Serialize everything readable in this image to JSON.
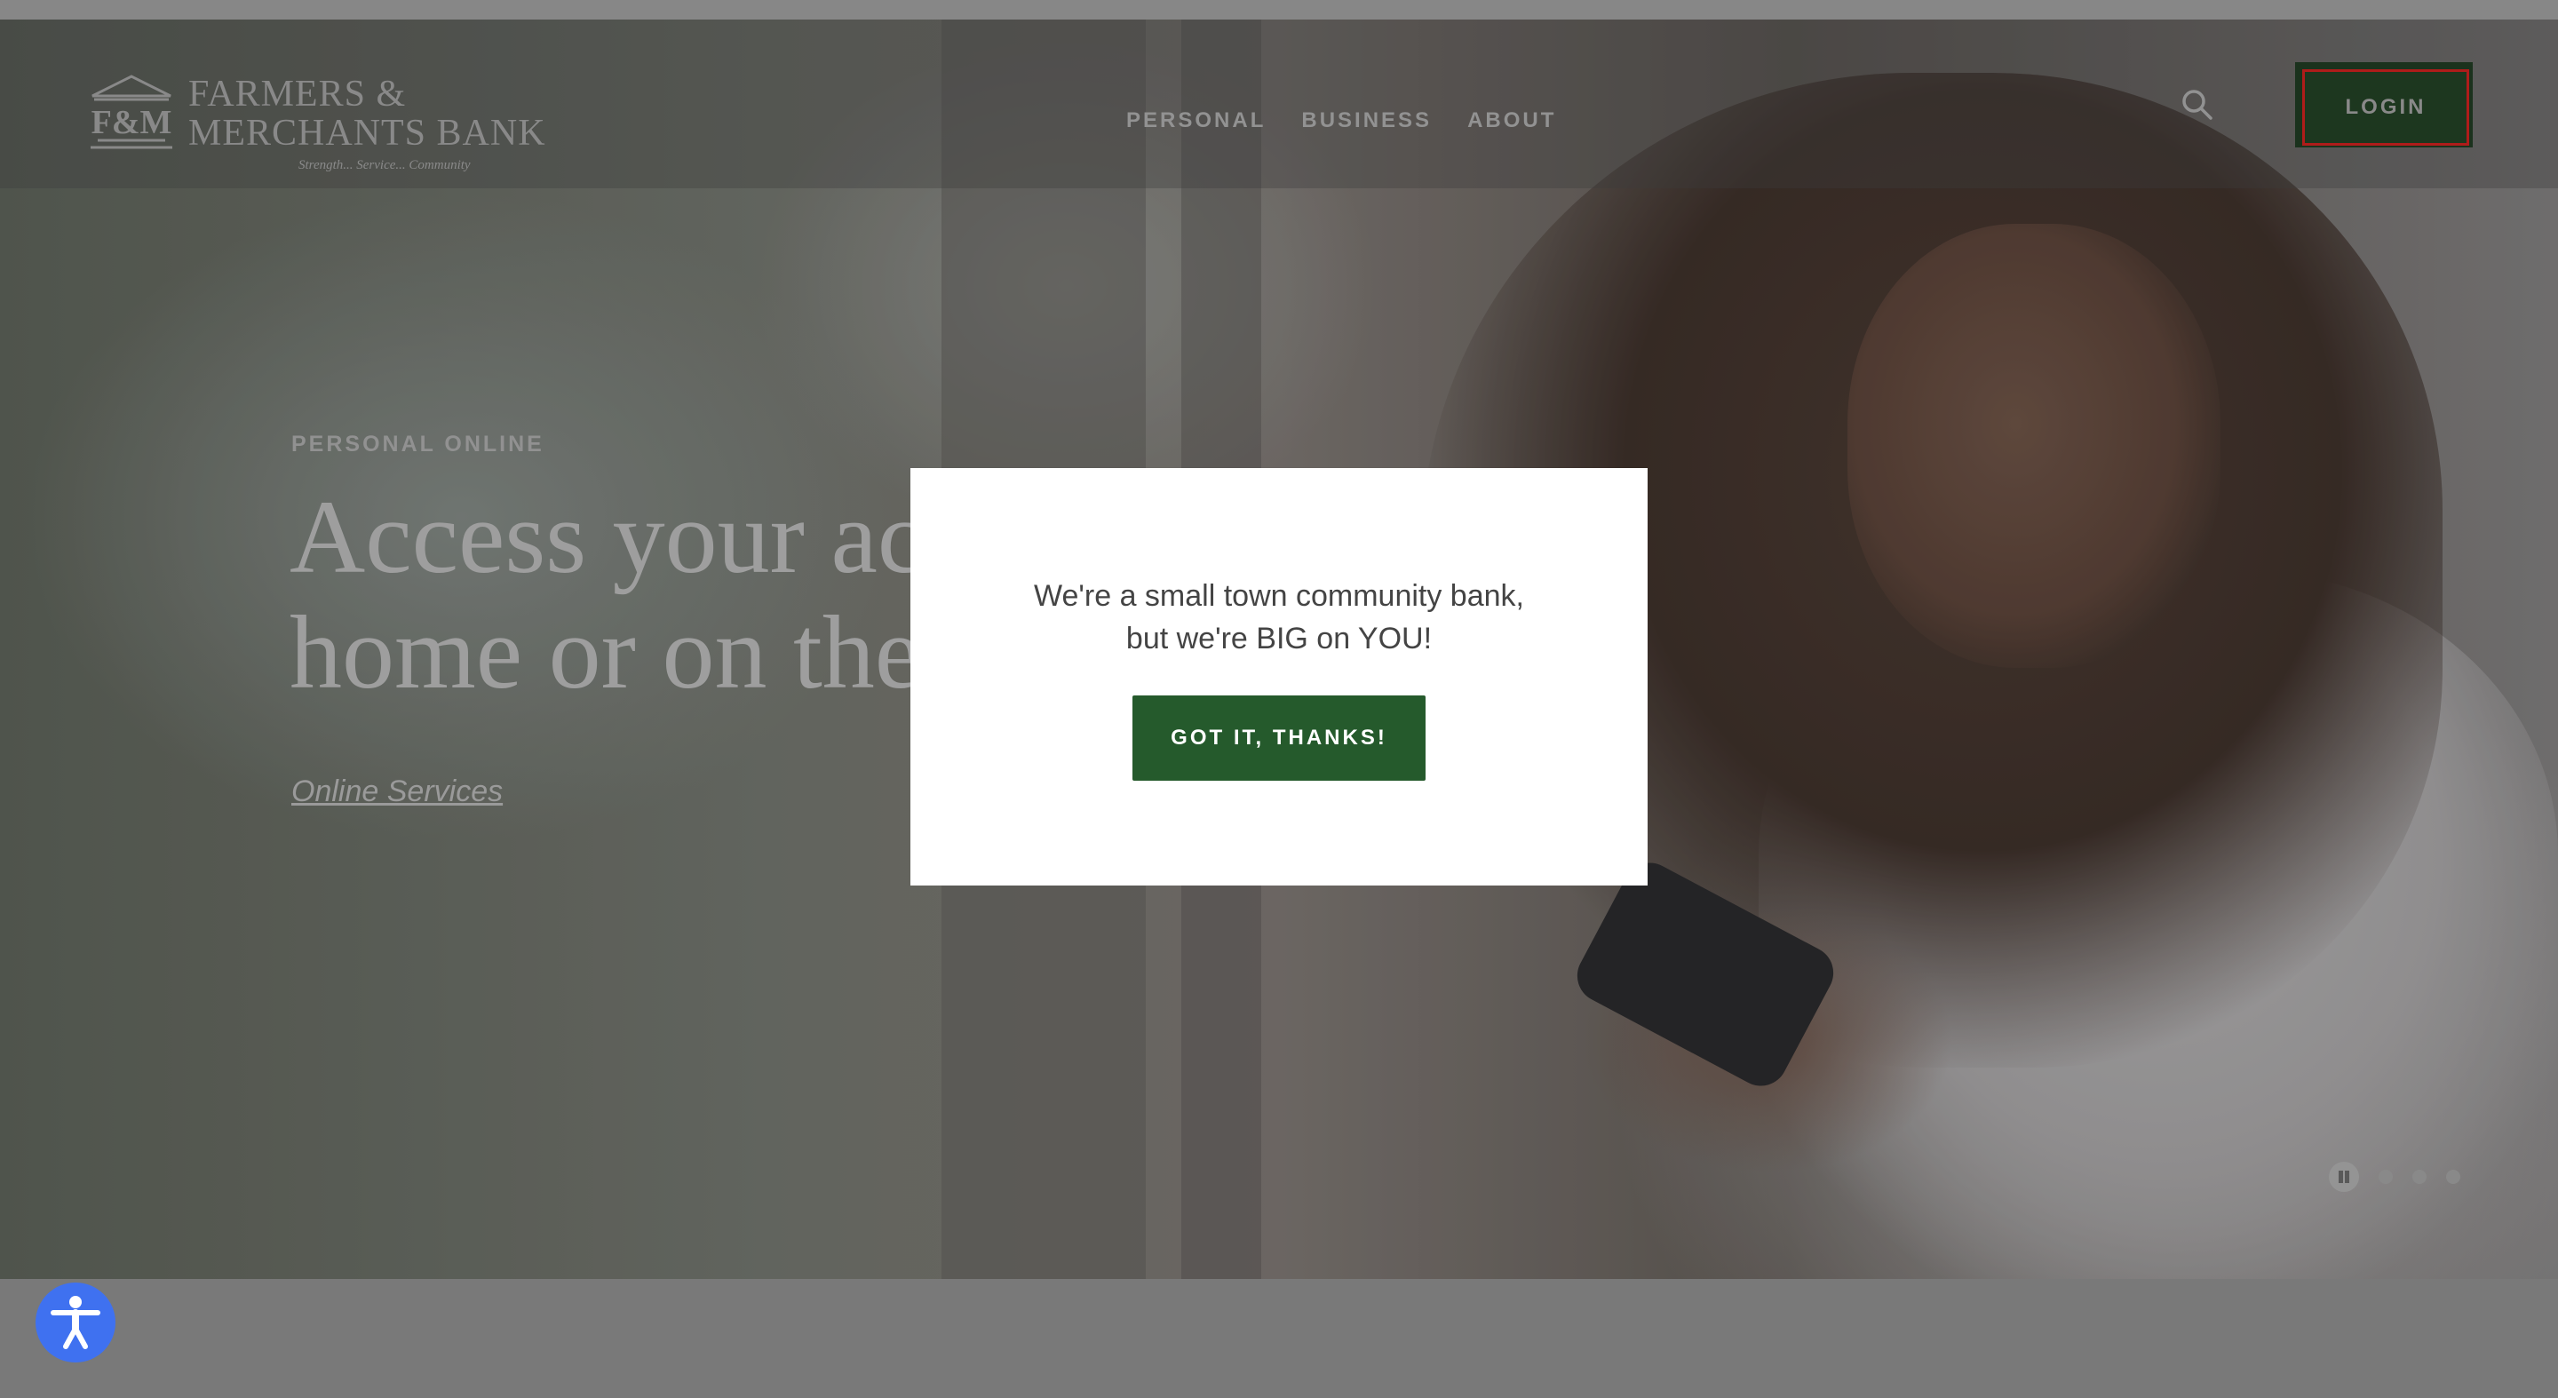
{
  "header": {
    "logo": {
      "mark": "F&M",
      "line1": "FARMERS &",
      "line2": "MERCHANTS BANK",
      "tagline": "Strength... Service... Community"
    },
    "nav": [
      "PERSONAL",
      "BUSINESS",
      "ABOUT"
    ],
    "search_icon": "search-icon",
    "login_label": "LOGIN"
  },
  "hero": {
    "eyebrow": "PERSONAL ONLINE",
    "headline_line1": "Access your ac",
    "headline_line2": "home or on the",
    "cta": "Online Services"
  },
  "carousel": {
    "pause_icon": "pause-icon",
    "dots": 3
  },
  "modal": {
    "line1": "We're a small town community bank,",
    "line2": "but we're BIG on YOU!",
    "button": "GOT IT, THANKS!"
  },
  "accessibility": {
    "icon": "accessibility-icon"
  },
  "colors": {
    "brand_green": "#255a2c",
    "login_outline": "#c8201e",
    "accessibility_blue": "#3f71f0"
  }
}
